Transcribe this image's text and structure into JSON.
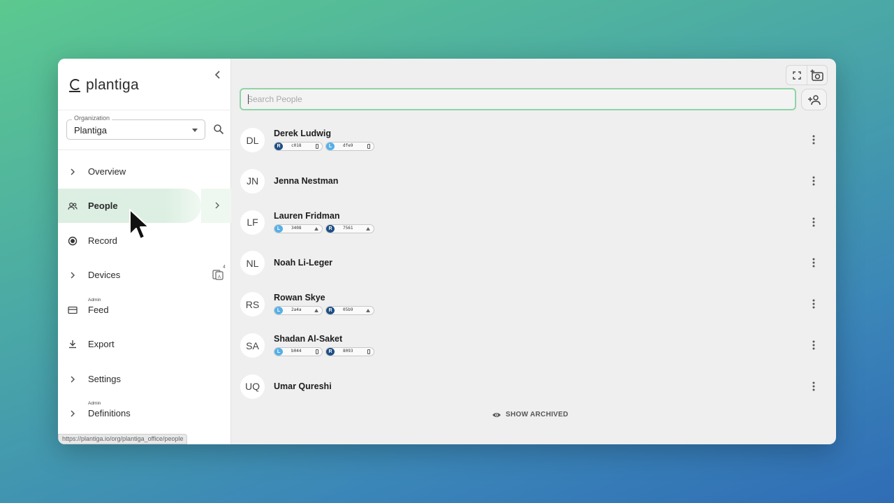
{
  "app": {
    "logo_text": "plantiga",
    "status_url": "https://plantiga.io/org/plantiga_office/people"
  },
  "organization": {
    "label": "Organization",
    "value": "Plantiga"
  },
  "nav": {
    "overview": "Overview",
    "people": "People",
    "record": "Record",
    "devices": "Devices",
    "devices_count": "4",
    "feed_admin": "Admin",
    "feed": "Feed",
    "export": "Export",
    "settings": "Settings",
    "definitions_admin": "Admin",
    "definitions": "Definitions"
  },
  "search": {
    "placeholder": "Search People"
  },
  "people": [
    {
      "initials": "DL",
      "name": "Derek Ludwig",
      "chips": [
        {
          "side": "R",
          "id": "c018"
        },
        {
          "side": "L",
          "id": "dfe9"
        }
      ]
    },
    {
      "initials": "JN",
      "name": "Jenna Nestman",
      "chips": []
    },
    {
      "initials": "LF",
      "name": "Lauren Fridman",
      "chips": [
        {
          "side": "L",
          "id": "3408"
        },
        {
          "side": "R",
          "id": "7561"
        }
      ]
    },
    {
      "initials": "NL",
      "name": "Noah Li-Leger",
      "chips": []
    },
    {
      "initials": "RS",
      "name": "Rowan Skye",
      "chips": [
        {
          "side": "L",
          "id": "2a4a"
        },
        {
          "side": "R",
          "id": "05b9"
        }
      ]
    },
    {
      "initials": "SA",
      "name": "Shadan Al-Saket",
      "chips": [
        {
          "side": "L",
          "id": "b044"
        },
        {
          "side": "R",
          "id": "8093"
        }
      ]
    },
    {
      "initials": "UQ",
      "name": "Umar Qureshi",
      "chips": []
    }
  ],
  "show_archived": "SHOW ARCHIVED",
  "colors": {
    "accent_green": "#8fd4a6",
    "active_nav_bg": "#dcefe2",
    "chip_right": "#1d4e84",
    "chip_left": "#55afe8"
  }
}
